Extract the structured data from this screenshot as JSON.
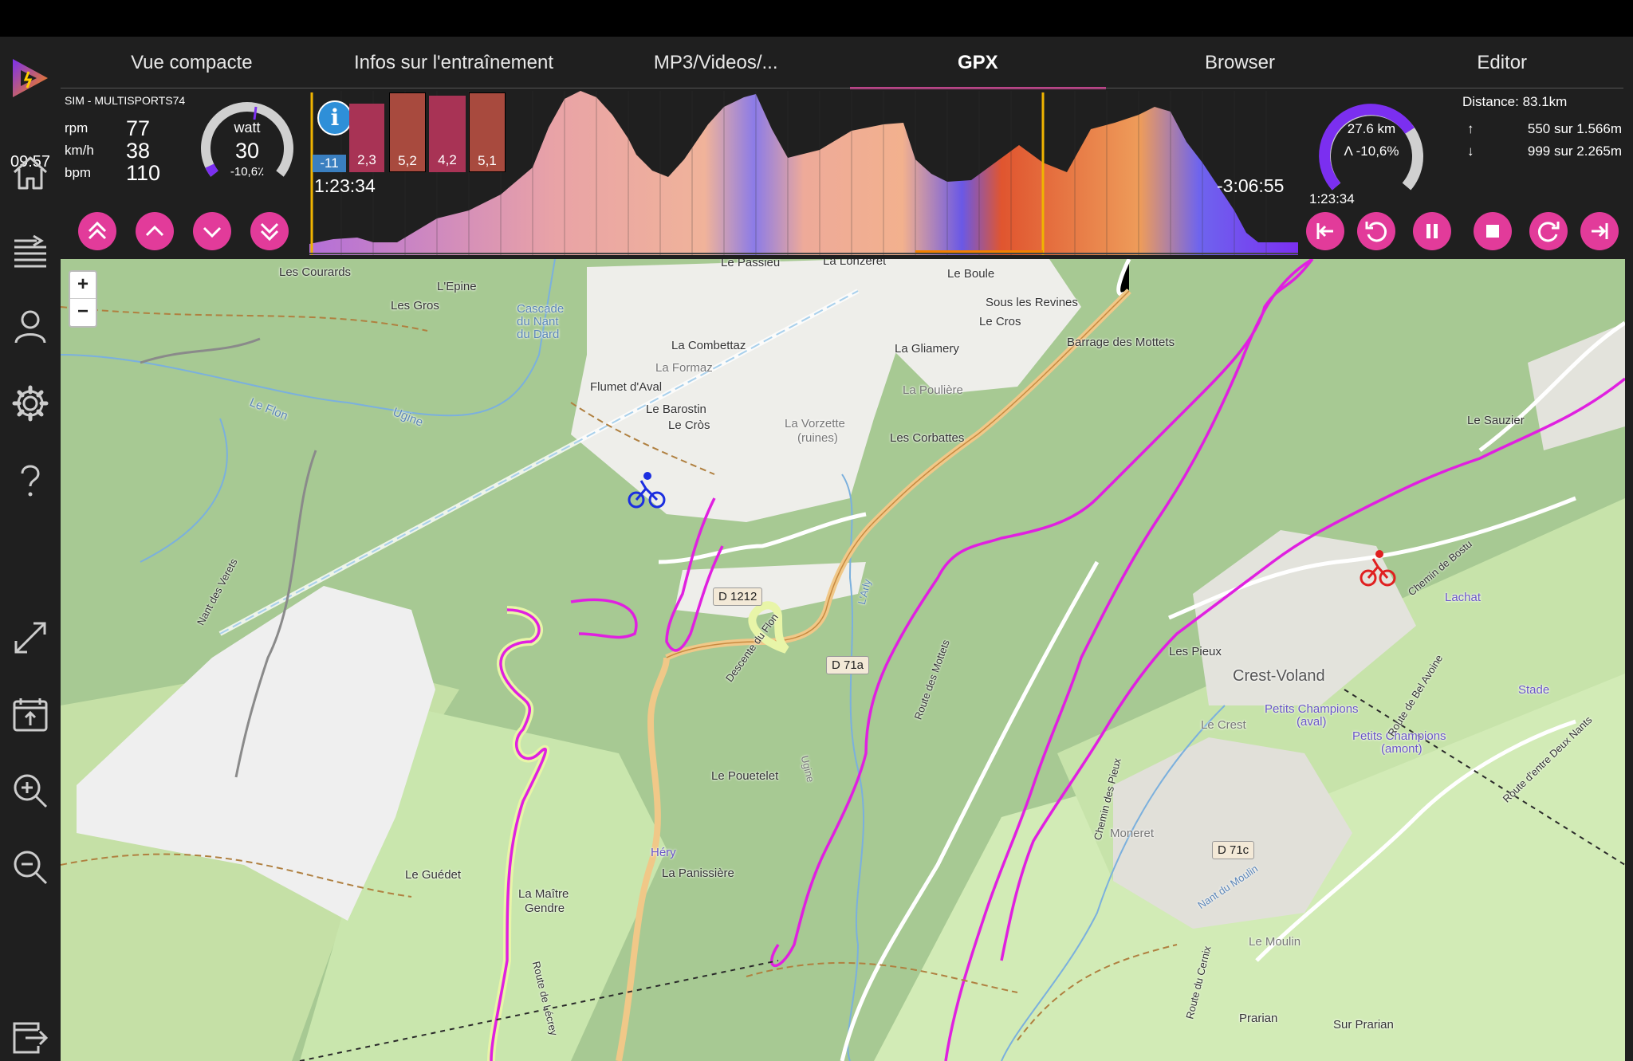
{
  "clock": "09:57",
  "tabs": [
    "Vue compacte",
    "Infos sur l'entraînement",
    "MP3/Videos/...",
    "GPX",
    "Browser",
    "Editor"
  ],
  "active_tab": "GPX",
  "stats": {
    "sim_label": "SIM - MULTISPORTS74",
    "rpm_unit": "rpm",
    "rpm_value": "77",
    "speed_unit": "km/h",
    "speed_value": "38",
    "hr_unit": "bpm",
    "hr_value": "110"
  },
  "power_gauge": {
    "label": "watt",
    "value": "30",
    "slope": "-10,6٪"
  },
  "profile": {
    "start_time": "1:23:34",
    "remaining": "-3:06:55",
    "segments": [
      "-11",
      "2,3",
      "5,2",
      "4,2",
      "5,1"
    ]
  },
  "progress_gauge": {
    "distance": "27.6 km",
    "grade": "Λ -10,6%",
    "time": "1:23:34"
  },
  "route_info": {
    "distance": "Distance: 83.1km",
    "up": "550 sur 1.566m",
    "down": "999 sur 2.265m"
  },
  "controls_left": [
    "fast-up",
    "up",
    "down",
    "fast-down"
  ],
  "controls_right": [
    "go-start",
    "rewind",
    "pause",
    "stop",
    "forward",
    "go-end"
  ],
  "map": {
    "zoom_in": "+",
    "zoom_out": "−",
    "labels": {
      "les_courards": "Les Courards",
      "l_epine": "L'Epine",
      "les_gros": "Les Gros",
      "cascade": "Cascade",
      "du_nant": "du Nant",
      "du_dard": "du Dard",
      "le_passieu": "Le Passieu",
      "la_lonzeret": "La Lonzeret",
      "le_boule": "Le Boule",
      "sous_les_revines": "Sous les Revines",
      "le_cros_n": "Le Cros",
      "barrage": "Barrage des Mottets",
      "la_combettaz": "La Combettaz",
      "la_gliamery": "La Gliamery",
      "la_formaz": "La Formaz",
      "flumet_aval": "Flumet d'Aval",
      "la_pouliere": "La Poulière",
      "le_barostin": "Le Barostin",
      "le_cros": "Le Cròs",
      "la_vorzette": "La Vorzette",
      "ruines": "(ruines)",
      "les_corbattes": "Les Corbattes",
      "le_sauzier": "Le Sauzier",
      "le_flon": "Le Flon",
      "ugine_stream": "Ugine",
      "lachat": "Lachat",
      "les_pieux": "Les Pieux",
      "crest_voland": "Crest-Voland",
      "petits_champions_aval": "Petits Champions",
      "aval": "(aval)",
      "petits_champions_amont": "Petits Champions",
      "amont": "(amont)",
      "le_crest": "Le Crest",
      "stade": "Stade",
      "le_pouetelet": "Le Pouetelet",
      "moneret": "Moneret",
      "hery": "Héry",
      "la_panissiere": "La Panissière",
      "le_guedet": "Le Guédet",
      "la_maitre": "La Maître",
      "gendre": "Gendre",
      "le_moulin": "Le Moulin",
      "prarian": "Prarian",
      "sur_prarian": "Sur Prarian",
      "d1212": "D 1212",
      "d71a": "D 71a",
      "d71c": "D 71c",
      "route_mottets": "Route des Mottets",
      "nant_verets": "Nant des Verets",
      "descente_flon": "Descente du Flon",
      "chemin_pieux": "Chemin des Pieux",
      "nant_moulin": "Nant du Moulin",
      "route_bel_avoine": "Route de Bel Avoine",
      "route_entre_deux_nants": "Route d'entre Deux Nants",
      "chemin_bostu": "Chemin de Bostu",
      "route_du_cernix": "Route du Cernix",
      "route_lecrey": "Route de Lécrey",
      "larly": "L'Arly",
      "ugine_road": "Ugine"
    }
  },
  "colors": {
    "accent": "#e23b9a",
    "route": "#e020e0",
    "gauge_purple": "#7b2ff0"
  }
}
